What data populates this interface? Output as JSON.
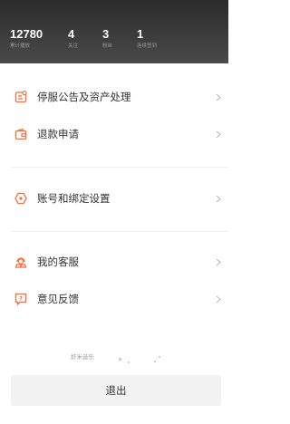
{
  "stats": [
    {
      "value": "12780",
      "label": "累计播放"
    },
    {
      "value": "4",
      "label": "关注"
    },
    {
      "value": "3",
      "label": "粉丝"
    },
    {
      "value": "1",
      "label": "连续签到"
    }
  ],
  "menu": {
    "items": [
      {
        "label": "停服公告及资产处理",
        "icon": "notice-icon"
      },
      {
        "label": "退款申请",
        "icon": "wallet-icon"
      },
      {
        "label": "账号和绑定设置",
        "icon": "account-settings-icon"
      },
      {
        "label": "我的客服",
        "icon": "customer-service-icon"
      },
      {
        "label": "意见反馈",
        "icon": "feedback-icon"
      }
    ]
  },
  "footer": {
    "watermark": "虾米音乐",
    "logout_label": "退出"
  },
  "colors": {
    "accent": "#ff6a36",
    "header_bg": "#333333"
  }
}
